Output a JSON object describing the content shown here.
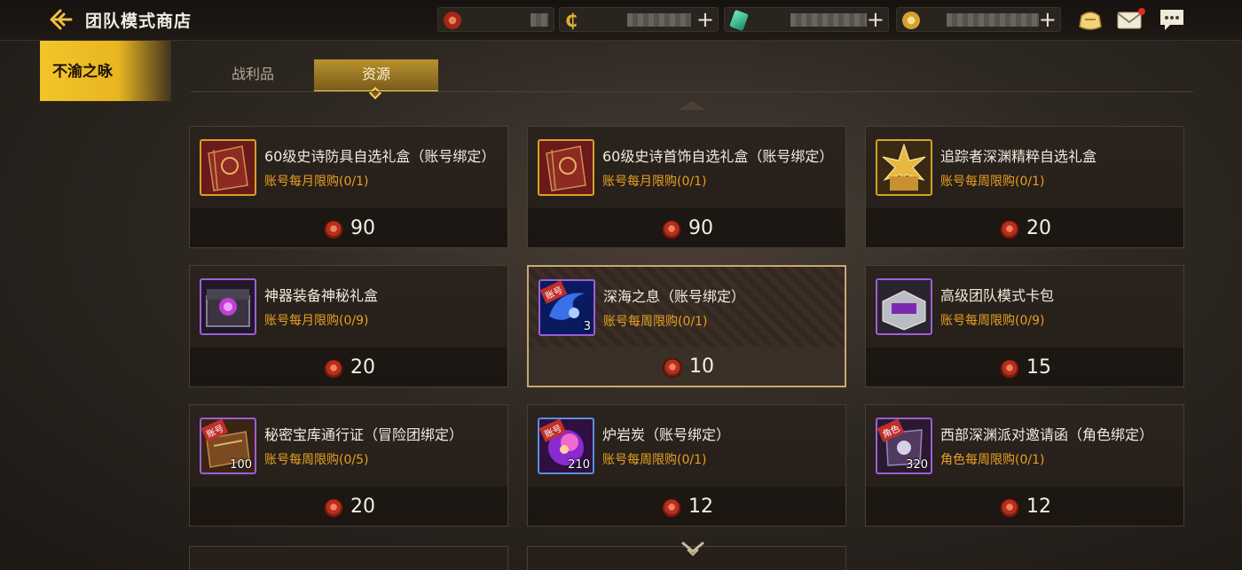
{
  "header": {
    "title": "团队模式商店"
  },
  "side_tab": {
    "label": "不渝之咏"
  },
  "tabs": [
    {
      "label": "战利品",
      "active": false
    },
    {
      "label": "资源",
      "active": true
    }
  ],
  "currency_icons": [
    "team-coin-icon",
    "gold-c-icon",
    "crystal-icon",
    "gold-coin-icon"
  ],
  "top_icons": [
    "bag-icon",
    "mail-icon",
    "chat-icon"
  ],
  "items": [
    {
      "name": "60级史诗防具自选礼盒（账号绑定）",
      "limit": "账号每月限购(0/1)",
      "price": "90",
      "icon": "red-gift-box-icon",
      "frame": "gold"
    },
    {
      "name": "60级史诗首饰自选礼盒（账号绑定）",
      "limit": "账号每月限购(0/1)",
      "price": "90",
      "icon": "red-gift-box-icon",
      "frame": "gold"
    },
    {
      "name": "追踪者深渊精粹自选礼盒",
      "limit": "账号每周限购(0/1)",
      "price": "20",
      "icon": "golden-flower-box-icon",
      "frame": "gold"
    },
    {
      "name": "神器装备神秘礼盒",
      "limit": "账号每月限购(0/9)",
      "price": "20",
      "icon": "purple-chest-icon",
      "frame": "purple"
    },
    {
      "name": "深海之息（账号绑定）",
      "limit": "账号每周限购(0/1)",
      "price": "10",
      "icon": "blue-swirl-icon",
      "frame": "purple",
      "badge": "账号",
      "qty": "3",
      "selected": true
    },
    {
      "name": "高级团队模式卡包",
      "limit": "账号每周限购(0/9)",
      "price": "15",
      "icon": "card-pack-icon",
      "frame": "purple"
    },
    {
      "name": "秘密宝库通行证（冒险团绑定）",
      "limit": "账号每周限购(0/5)",
      "price": "20",
      "icon": "pass-book-icon",
      "frame": "purple",
      "badge": "账号",
      "qty": "100"
    },
    {
      "name": "炉岩炭（账号绑定）",
      "limit": "账号每周限购(0/1)",
      "price": "12",
      "icon": "lava-coal-icon",
      "frame": "blue",
      "badge": "账号",
      "qty": "210"
    },
    {
      "name": "西部深渊派对邀请函（角色绑定）",
      "limit": "角色每周限购(0/1)",
      "price": "12",
      "icon": "invitation-icon",
      "frame": "purple",
      "badge": "角色",
      "qty": "320"
    }
  ]
}
